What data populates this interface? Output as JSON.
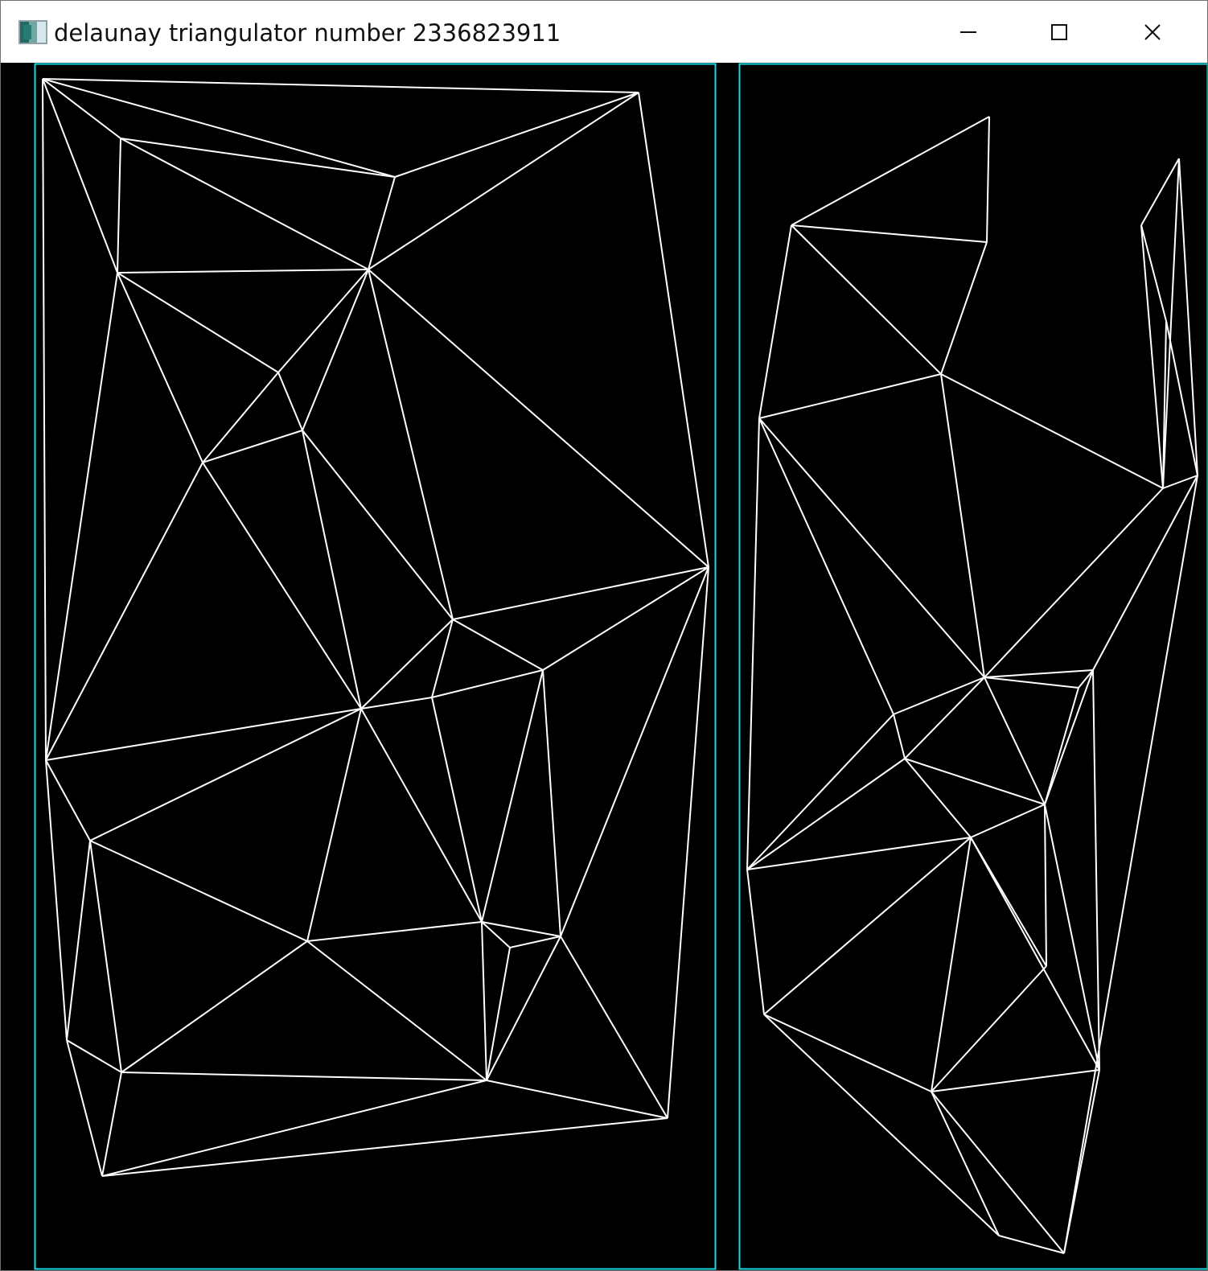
{
  "window": {
    "title": "delaunay triangulator number 2336823911",
    "icon": "application-icon",
    "controls": [
      "minimize",
      "maximize",
      "close"
    ]
  },
  "canvas": {
    "background": "#000000",
    "panel_border_color": "#18d8e2",
    "edge_color": "#ffffff"
  }
}
